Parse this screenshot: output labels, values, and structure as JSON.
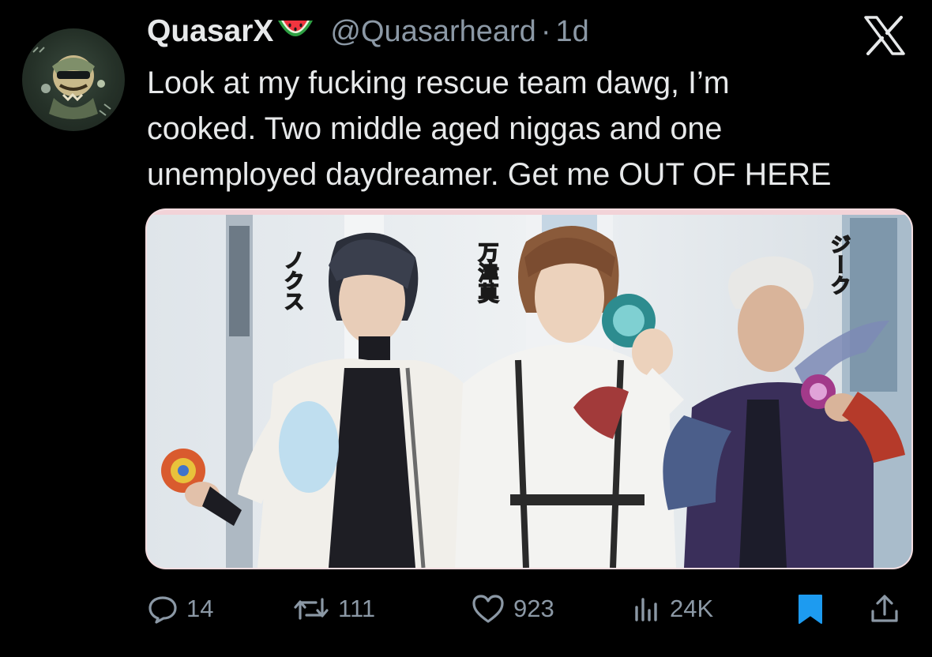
{
  "tweet": {
    "display_name": "QuasarX",
    "handle": "@Quasarheard",
    "separator": "·",
    "time": "1d",
    "text_lines": [
      "Look at my fucking rescue team dawg, I’m",
      "cooked. Two middle aged niggas and one",
      "unemployed daydreamer. Get me OUT OF HERE"
    ]
  },
  "media": {
    "captions": [
      "ノクス",
      "万津莫",
      "ジーク"
    ]
  },
  "actions": {
    "replies": "14",
    "reposts": "111",
    "likes": "923",
    "views": "24K"
  },
  "icons": {
    "reply": "reply-icon",
    "repost": "repost-icon",
    "like": "heart-icon",
    "views": "views-icon",
    "bookmark": "bookmark-icon",
    "share": "share-icon",
    "platform": "x-logo-icon",
    "name_emoji": "watermelon-emoji"
  },
  "colors": {
    "background": "#000000",
    "text": "#e7e9ea",
    "secondary": "#8b98a5",
    "bookmark_active": "#1d9bf0"
  }
}
